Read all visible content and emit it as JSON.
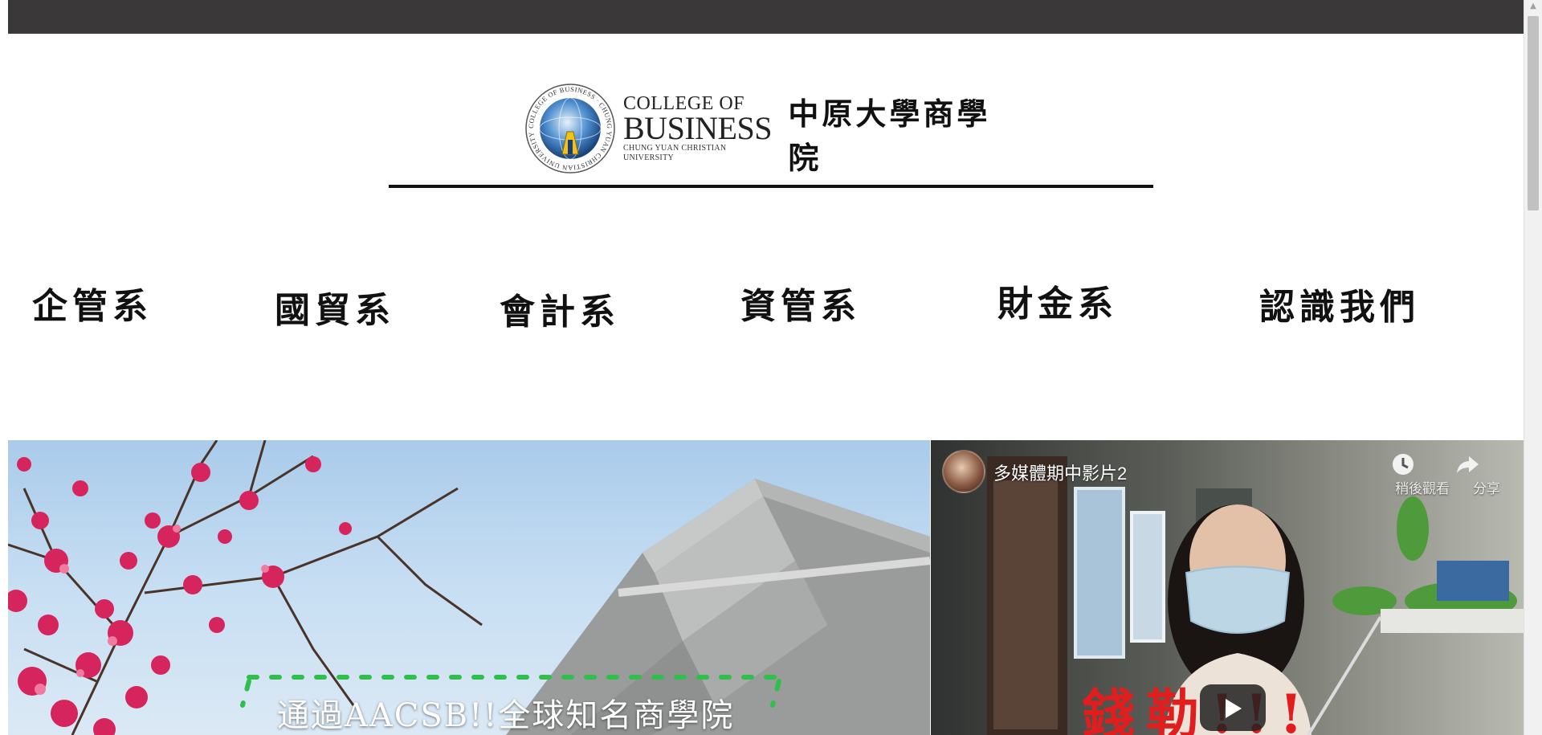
{
  "logo": {
    "line1": "COLLEGE OF",
    "line2": "BUSINESS",
    "line3": "CHUNG YUAN CHRISTIAN UNIVERSITY",
    "zh_name": "中原大學商學院",
    "emblem_text": "COLLEGE OF BUSINESS · CHUNG YUAN CHRISTIAN UNIVERSITY"
  },
  "nav": {
    "items": [
      {
        "label": "企管系"
      },
      {
        "label": "國貿系"
      },
      {
        "label": "會計系"
      },
      {
        "label": "資管系"
      },
      {
        "label": "財金系"
      },
      {
        "label": "認識我們"
      }
    ]
  },
  "hero": {
    "caption": "通過AACSB!!全球知名商學院"
  },
  "video": {
    "title": "多媒體期中影片2",
    "watch_later_label": "稍後觀看",
    "share_label": "分享",
    "subtitle": "錢勒!!!"
  },
  "colors": {
    "topbar": "#3a3838",
    "subtitle_red": "#e01e1e",
    "blossom": "#d6245c"
  }
}
